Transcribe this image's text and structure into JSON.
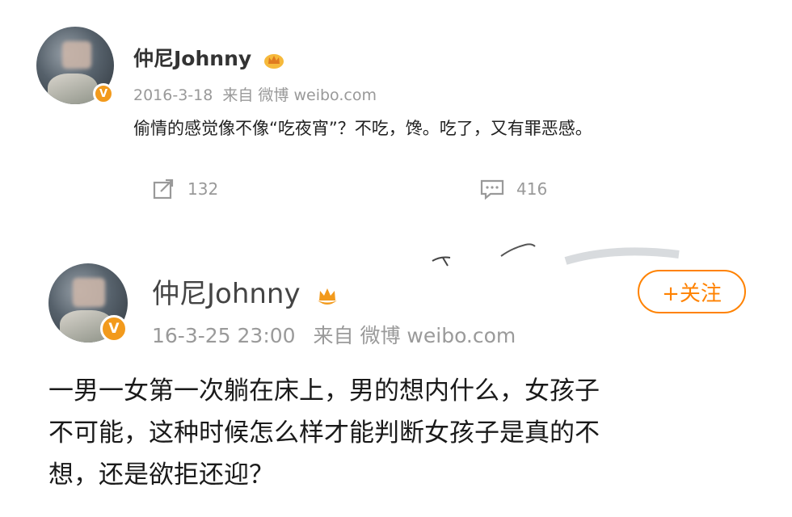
{
  "post1": {
    "username": "仲尼Johnny",
    "date": "2016-3-18",
    "source": "来自 微博 weibo.com",
    "text": "偷情的感觉像不像“吃夜宵”？不吃，馋。吃了，又有罪恶感。",
    "repost_count": "132",
    "comment_count": "416",
    "icons": {
      "badge": "v-badge-icon",
      "crown": "crown-icon",
      "repost": "repost-icon",
      "comment": "comment-icon"
    }
  },
  "post2": {
    "username": "仲尼Johnny",
    "date": "16-3-25 23:00",
    "source": "来自 微博 weibo.com",
    "text_lines": [
      "一男一女第一次躺在床上，男的想内什么，女孩子",
      "不可能，这种时候怎么样才能判断女孩子是真的不",
      "想，还是欲拒还迎？"
    ],
    "follow_label": "+关注",
    "icons": {
      "badge": "v-badge-icon",
      "crown": "crown-icon"
    }
  },
  "colors": {
    "accent": "#ff8200",
    "badge": "#f29a1c",
    "meta": "#999999"
  }
}
